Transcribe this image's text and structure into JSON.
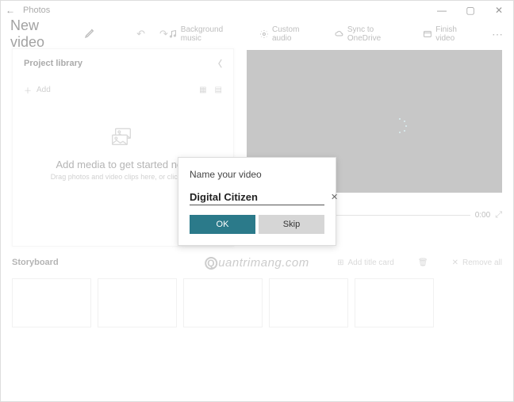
{
  "titlebar": {
    "app_name": "Photos"
  },
  "header": {
    "video_title": "New video",
    "toolbar": {
      "bg_music": "Background music",
      "custom_audio": "Custom audio",
      "sync": "Sync to OneDrive",
      "finish": "Finish video"
    }
  },
  "library": {
    "title": "Project library",
    "add": "Add",
    "empty_title": "Add media to get started now",
    "empty_sub": "Drag photos and video clips here, or click Add"
  },
  "preview": {
    "time": "0:00"
  },
  "storyboard": {
    "title": "Storyboard",
    "add_title_card": "Add title card",
    "remove_all": "Remove all"
  },
  "dialog": {
    "title": "Name your video",
    "value": "Digital Citizen",
    "ok": "OK",
    "skip": "Skip"
  },
  "watermark": "uantrimang.com"
}
